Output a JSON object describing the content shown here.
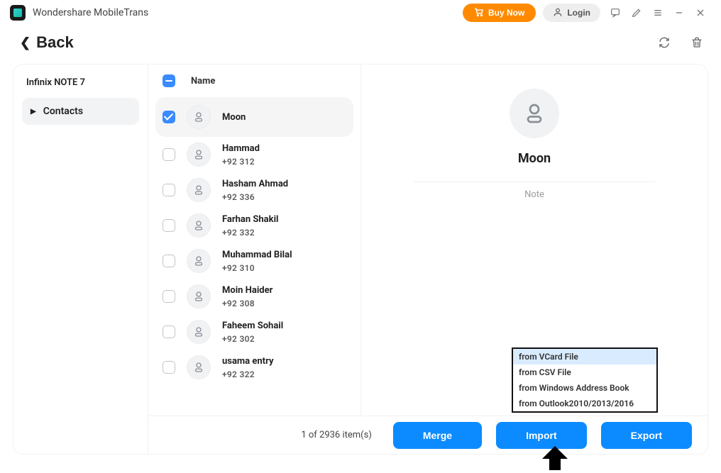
{
  "app": {
    "title": "Wondershare MobileTrans"
  },
  "titlebar": {
    "buy_label": "Buy Now",
    "login_label": "Login"
  },
  "nav": {
    "back_label": "Back"
  },
  "sidebar": {
    "device_name": "Infinix NOTE 7",
    "items": [
      {
        "label": "Contacts"
      }
    ]
  },
  "list": {
    "header_name": "Name"
  },
  "contacts": [
    {
      "name": "Moon",
      "phone": null,
      "checked": true,
      "selected": true
    },
    {
      "name": "Hammad",
      "phone": "+92 312",
      "checked": false,
      "selected": false
    },
    {
      "name": "Hasham Ahmad",
      "phone": "+92 336",
      "checked": false,
      "selected": false
    },
    {
      "name": "Farhan Shakil",
      "phone": "+92 332",
      "checked": false,
      "selected": false
    },
    {
      "name": "Muhammad Bilal",
      "phone": "+92 310",
      "checked": false,
      "selected": false
    },
    {
      "name": "Moin Haider",
      "phone": "+92 308",
      "checked": false,
      "selected": false
    },
    {
      "name": "Faheem Sohail",
      "phone": "+92 302",
      "checked": false,
      "selected": false
    },
    {
      "name": "usama entry",
      "phone": "+92 322",
      "checked": false,
      "selected": false
    }
  ],
  "detail": {
    "name": "Moon",
    "note_label": "Note"
  },
  "footer": {
    "count_text": "1 of 2936 item(s)",
    "merge_label": "Merge",
    "import_label": "Import",
    "export_label": "Export"
  },
  "import_menu": {
    "options": [
      "from VCard File",
      "from CSV File",
      "from Windows Address Book",
      "from Outlook2010/2013/2016"
    ],
    "highlighted_index": 0
  }
}
